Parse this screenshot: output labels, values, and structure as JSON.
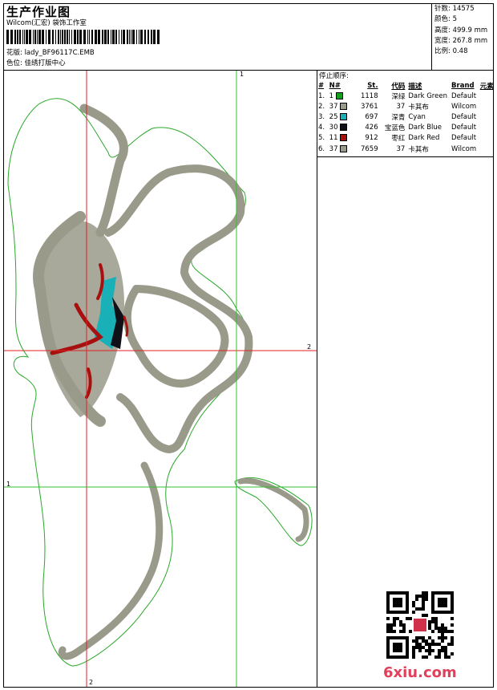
{
  "header": {
    "title": "生产作业图",
    "studio": "Wilcom(汇宏) 袋饰工作室",
    "pattern": "花版: lady_BF96117C.EMB",
    "colorway": "色位: 佳绣打版中心"
  },
  "stats": {
    "stitches": "针数: 14575",
    "colors": "颜色: 5",
    "height": "高度: 499.9 mm",
    "width": "宽度: 267.8 mm",
    "scale": "比例: 0.48"
  },
  "stop_sequence": {
    "title": "停止顺序:",
    "headers": [
      "#",
      "N#",
      "St.",
      "代码",
      "描述",
      "Brand",
      "元素"
    ],
    "rows": [
      {
        "num": "1.",
        "n": "1",
        "color": "#14a01e",
        "st": "1118",
        "code": "深绿",
        "desc": "Dark Green",
        "brand": "Default"
      },
      {
        "num": "2.",
        "n": "37",
        "color": "#9a9a8a",
        "st": "3761",
        "code": "37",
        "desc": "卡其布",
        "brand": "Wilcom"
      },
      {
        "num": "3.",
        "n": "25",
        "color": "#1ab0b8",
        "st": "697",
        "code": "深青",
        "desc": "Cyan",
        "brand": "Default"
      },
      {
        "num": "4.",
        "n": "30",
        "color": "#101018",
        "st": "426",
        "code": "宝蓝色",
        "desc": "Dark Blue",
        "brand": "Default"
      },
      {
        "num": "5.",
        "n": "11",
        "color": "#a81010",
        "st": "912",
        "code": "枣红",
        "desc": "Dark Red",
        "brand": "Default"
      },
      {
        "num": "6.",
        "n": "37",
        "color": "#9a9a8a",
        "st": "7659",
        "code": "37",
        "desc": "卡其布",
        "brand": "Wilcom"
      }
    ]
  },
  "axes": {
    "top_green": "1",
    "right_red": "2",
    "left_green": "1",
    "bottom_red": "2"
  },
  "watermark": "6xiu.com"
}
